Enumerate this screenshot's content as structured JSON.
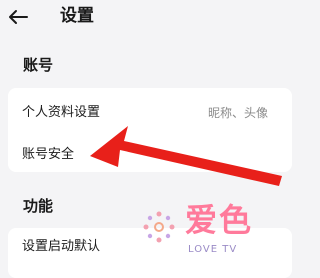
{
  "header": {
    "title": "设置",
    "back_icon": "arrow-left-icon"
  },
  "sections": {
    "account": {
      "title": "账号",
      "items": [
        {
          "label": "个人资料设置",
          "value": "昵称、头像"
        },
        {
          "label": "账号安全"
        }
      ]
    },
    "features": {
      "title": "功能",
      "items": [
        {
          "label": "设置启动默认"
        }
      ]
    }
  },
  "watermark": {
    "text": "爱色",
    "subtext": "LOVE TV"
  },
  "colors": {
    "background": "#f4f4f6",
    "card": "#ffffff",
    "arrow": "#e8201a",
    "watermark": "#ff7a9b"
  }
}
